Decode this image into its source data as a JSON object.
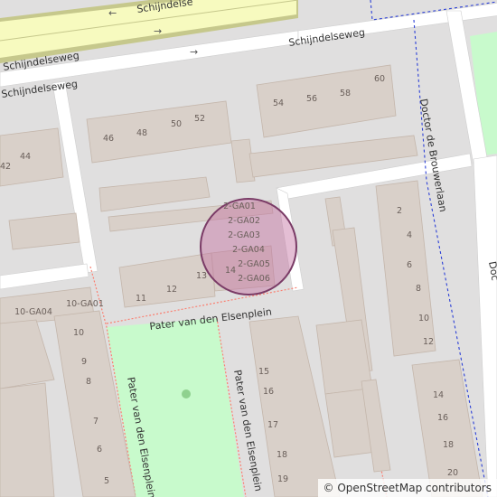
{
  "streets": {
    "schijndelseweg_top": "Schijndelse",
    "schijndelseweg_main": "Schijndelseweg",
    "schijndelseweg_right": "Schijndelseweg",
    "schijndelseweg_left": "Schijndelseweg",
    "brouwerlaan": "Doctor de Brouwerlaan",
    "brouwerlaan_edge": "Doc",
    "pater_horizontal": "Pater van den Elsenplein",
    "pater_vertical_left": "Pater van den Elsenplein",
    "pater_vertical_right": "Pater van den Elsenplein"
  },
  "house_numbers": {
    "h46": "46",
    "h48": "48",
    "h50": "50",
    "h52": "52",
    "h54": "54",
    "h56": "56",
    "h58": "58",
    "h60": "60",
    "h42": "42",
    "h44": "44",
    "h11": "11",
    "h12": "12",
    "h13": "13",
    "h14": "14",
    "ga01": "2-GA01",
    "ga02": "2-GA02",
    "ga03": "2-GA03",
    "ga04": "2-GA04",
    "ga05": "2-GA05",
    "ga06": "2-GA06",
    "l10ga04": "10-GA04",
    "l10ga01": "10-GA01",
    "l10": "10",
    "l9": "9",
    "l8": "8",
    "l7": "7",
    "l6": "6",
    "l5": "5",
    "m15": "15",
    "m16": "16",
    "m17": "17",
    "m18": "18",
    "m19": "19",
    "r2": "2",
    "r4": "4",
    "r6": "6",
    "r8": "8",
    "r10": "10",
    "r12": "12",
    "r14": "14",
    "r16": "16",
    "r18": "18",
    "r20": "20"
  },
  "colors": {
    "background": "#e0dfdf",
    "building": "#d9d0c9",
    "building_stroke": "#c4b6ab",
    "road": "#ffffff",
    "primary_road": "#f7fabf",
    "primary_road_casing": "#c6c88c",
    "park": "#c8facc",
    "boundary_blue": "#2b3fd6",
    "path_red": "#fa8072",
    "marker_fill": "#c46ea0",
    "marker_stroke": "#7a3b66"
  },
  "attribution": "© OpenStreetMap contributors"
}
